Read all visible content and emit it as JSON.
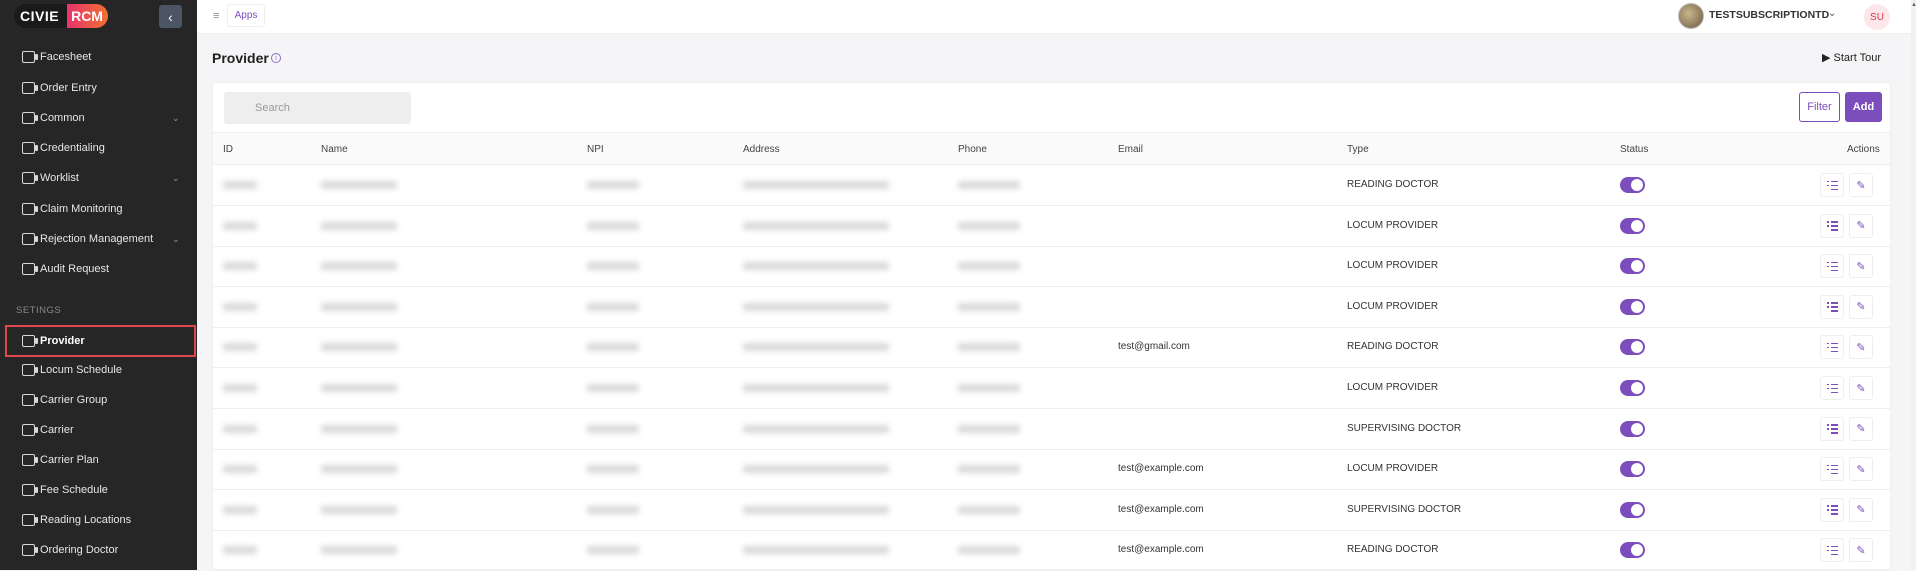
{
  "app": {
    "logo_left": "CIVIE",
    "logo_right": "RCM"
  },
  "sidebar": {
    "items": [
      {
        "label": "Facesheet",
        "chevron": false
      },
      {
        "label": "Order Entry",
        "chevron": false
      },
      {
        "label": "Common",
        "chevron": true
      },
      {
        "label": "Credentialing",
        "chevron": false
      },
      {
        "label": "Worklist",
        "chevron": true
      },
      {
        "label": "Claim Monitoring",
        "chevron": false
      },
      {
        "label": "Rejection Management",
        "chevron": true
      },
      {
        "label": "Audit Request",
        "chevron": false
      }
    ],
    "section_label": "SETINGS",
    "settings_items": [
      {
        "label": "Provider",
        "active": true
      },
      {
        "label": "Locum Schedule"
      },
      {
        "label": "Carrier Group"
      },
      {
        "label": "Carrier"
      },
      {
        "label": "Carrier Plan"
      },
      {
        "label": "Fee Schedule"
      },
      {
        "label": "Reading Locations"
      },
      {
        "label": "Ordering Doctor"
      }
    ]
  },
  "topbar": {
    "apps_tab": "Apps",
    "user_name": "TESTSUBSCRIPTIONTD",
    "user_initials": "SU"
  },
  "page": {
    "title": "Provider",
    "start_tour": "Start Tour",
    "search_placeholder": "Search",
    "filter_label": "Filter",
    "add_label": "Add"
  },
  "table": {
    "columns": [
      "ID",
      "Name",
      "NPI",
      "Address",
      "Phone",
      "Email",
      "Type",
      "Status",
      "Actions"
    ],
    "rows": [
      {
        "id": "",
        "name": "",
        "npi": "",
        "address": "",
        "phone": "",
        "email": "",
        "type": "READING DOCTOR",
        "status": true
      },
      {
        "id": "",
        "name": "",
        "npi": "",
        "address": "",
        "phone": "",
        "email": "",
        "type": "LOCUM PROVIDER",
        "status": true
      },
      {
        "id": "",
        "name": "",
        "npi": "",
        "address": "",
        "phone": "",
        "email": "",
        "type": "LOCUM PROVIDER",
        "status": true
      },
      {
        "id": "",
        "name": "",
        "npi": "",
        "address": "",
        "phone": "",
        "email": "",
        "type": "LOCUM PROVIDER",
        "status": true
      },
      {
        "id": "",
        "name": "",
        "npi": "",
        "address": "",
        "phone": "",
        "email": "test@gmail.com",
        "type": "READING DOCTOR",
        "status": true
      },
      {
        "id": "",
        "name": "",
        "npi": "",
        "address": "",
        "phone": "",
        "email": "",
        "type": "LOCUM PROVIDER",
        "status": true
      },
      {
        "id": "",
        "name": "",
        "npi": "",
        "address": "",
        "phone": "",
        "email": "",
        "type": "SUPERVISING DOCTOR",
        "status": true
      },
      {
        "id": "",
        "name": "",
        "npi": "",
        "address": "",
        "phone": "",
        "email": "test@example.com",
        "type": "LOCUM PROVIDER",
        "status": true
      },
      {
        "id": "",
        "name": "",
        "npi": "",
        "address": "",
        "phone": "",
        "email": "test@example.com",
        "type": "SUPERVISING DOCTOR",
        "status": true
      },
      {
        "id": "",
        "name": "",
        "npi": "",
        "address": "",
        "phone": "",
        "email": "test@example.com",
        "type": "READING DOCTOR",
        "status": true
      }
    ]
  },
  "colors": {
    "accent": "#7c4dbd",
    "sidebar_bg": "#262626",
    "highlight_border": "#e0474c"
  },
  "icons": {
    "nav": "document-icon",
    "search": "search-icon",
    "info": "info-icon",
    "play": "play-icon",
    "list": "list-icon",
    "edit": "edit-icon"
  }
}
